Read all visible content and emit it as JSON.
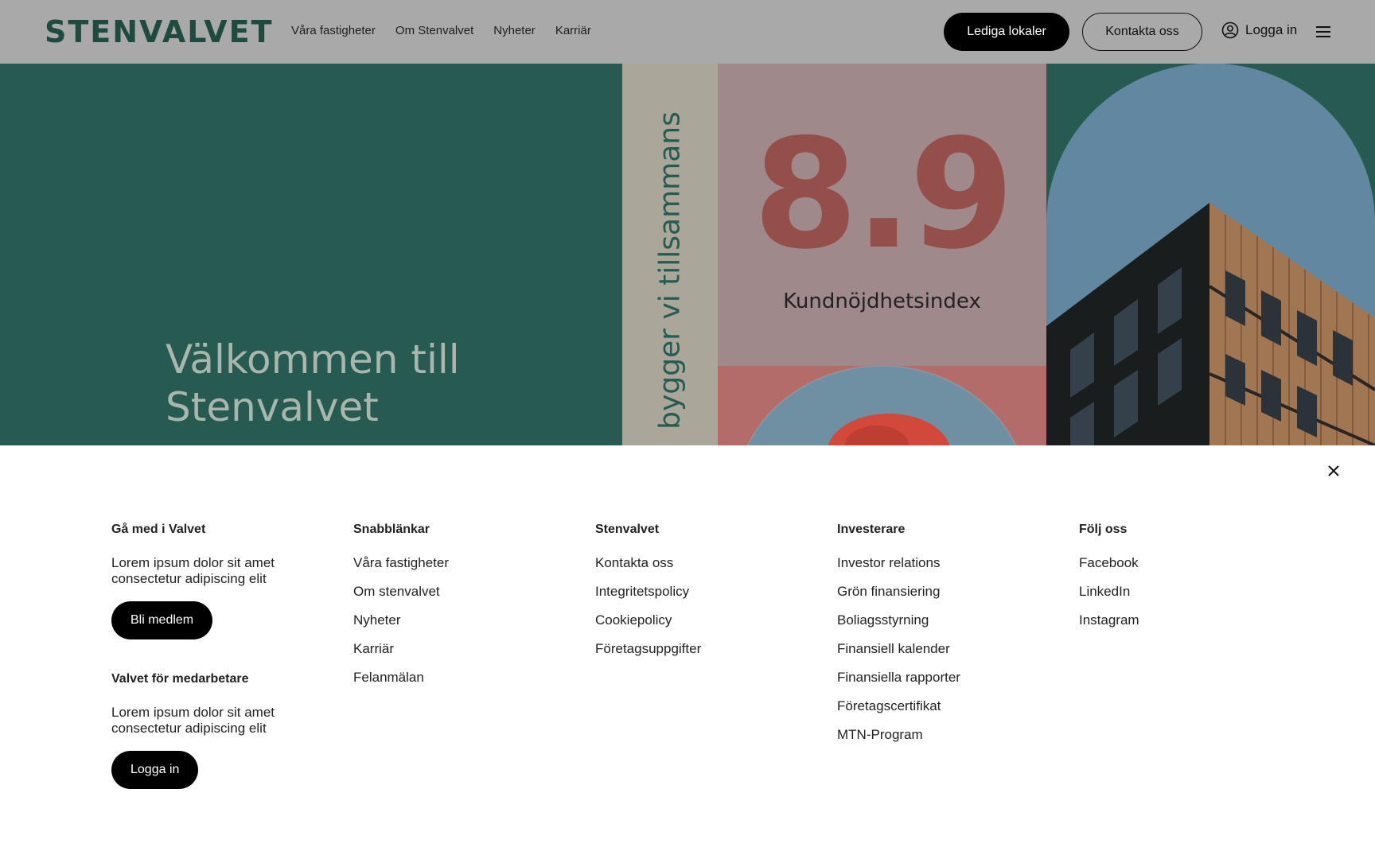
{
  "header": {
    "logo": "STENVALVET",
    "nav": [
      "Våra fastigheter",
      "Om Stenvalvet",
      "Nyheter",
      "Karriär"
    ],
    "cta_primary": "Lediga lokaler",
    "cta_secondary": "Kontakta oss",
    "login_label": "Logga in",
    "login_icon": "user-circle-icon",
    "menu_icon": "hamburger-menu-icon"
  },
  "hero": {
    "title": "Välkommen till Stenvalvet",
    "vertical_text": "bygger vi tillsammans",
    "score": "8.9",
    "score_label": "Kundnöjdhetsindex",
    "colors": {
      "green": "#275b51",
      "title_text": "#a8b6ae",
      "strip": "#aaa79a",
      "pink": "#a0898b",
      "score_text": "#954f4b",
      "red": "#b46c68",
      "sky": "#6287a1"
    }
  },
  "overlay": {
    "close_icon": "close-icon",
    "join": {
      "heading": "Gå med i Valvet",
      "text": "Lorem ipsum dolor sit amet consectetur adipiscing elit",
      "button": "Bli medlem"
    },
    "staff": {
      "heading": "Valvet för medarbetare",
      "text": "Lorem ipsum dolor sit amet consectetur adipiscing elit",
      "button": "Logga in"
    },
    "columns": [
      {
        "heading": "Snabblänkar",
        "links": [
          "Våra fastigheter",
          "Om stenvalvet",
          "Nyheter",
          "Karriär",
          "Felanmälan"
        ]
      },
      {
        "heading": "Stenvalvet",
        "links": [
          "Kontakta oss",
          "Integritetspolicy",
          "Cookiepolicy",
          "Företagsuppgifter"
        ]
      },
      {
        "heading": "Investerare",
        "links": [
          "Investor relations",
          "Grön finansiering",
          "Boliagsstyrning",
          "Finansiell kalender",
          "Finansiella rapporter",
          "Företagscertifikat",
          "MTN-Program"
        ]
      },
      {
        "heading": "Följ oss",
        "links": [
          "Facebook",
          "LinkedIn",
          "Instagram"
        ]
      }
    ]
  }
}
